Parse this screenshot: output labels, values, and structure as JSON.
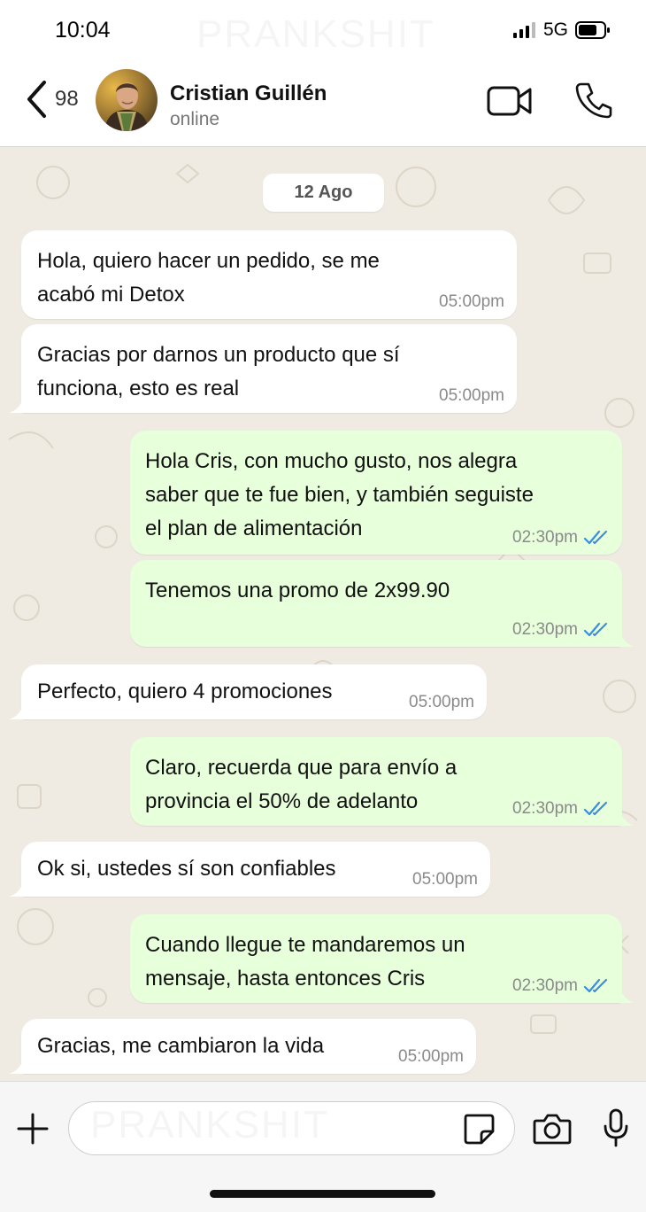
{
  "status_bar": {
    "time": "10:04",
    "network": "5G"
  },
  "header": {
    "back_count": "98",
    "contact_name": "Cristian Guillén",
    "contact_status": "online"
  },
  "chat": {
    "date_label": "12 Ago",
    "messages": [
      {
        "direction": "in",
        "text": "Hola, quiero hacer un pedido, se me\nacabó mi Detox",
        "time": "05:00pm"
      },
      {
        "direction": "in",
        "text": "Gracias por darnos un producto que sí\nfunciona, esto es real",
        "time": "05:00pm"
      },
      {
        "direction": "out",
        "text": "Hola Cris, con mucho gusto, nos alegra\nsaber que te fue bien, y también seguiste\nel plan de alimentación",
        "time": "02:30pm",
        "read": true
      },
      {
        "direction": "out",
        "text": "Tenemos una promo de 2x99.90",
        "time": "02:30pm",
        "read": true
      },
      {
        "direction": "in",
        "text": "Perfecto, quiero 4 promociones",
        "time": "05:00pm"
      },
      {
        "direction": "out",
        "text": "Claro, recuerda que para envío a\nprovincia el 50% de adelanto",
        "time": "02:30pm",
        "read": true
      },
      {
        "direction": "in",
        "text": "Ok si, ustedes sí son confiables",
        "time": "05:00pm"
      },
      {
        "direction": "out",
        "text": "Cuando llegue te mandaremos un\nmensaje, hasta entonces Cris",
        "time": "02:30pm",
        "read": true
      },
      {
        "direction": "in",
        "text": "Gracias, me cambiaron la vida",
        "time": "05:00pm"
      }
    ]
  },
  "input": {
    "value": ""
  },
  "watermark": "PRANKSHIT",
  "colors": {
    "incoming_bubble": "#ffffff",
    "outgoing_bubble": "#e7ffdb",
    "chat_background": "#efeae2",
    "read_ticks": "#3b8de0"
  },
  "icons": [
    "back-chevron-icon",
    "video-camera-icon",
    "phone-icon",
    "plus-icon",
    "sticker-icon",
    "camera-icon",
    "microphone-icon",
    "double-check-icon",
    "signal-icon",
    "battery-icon"
  ]
}
